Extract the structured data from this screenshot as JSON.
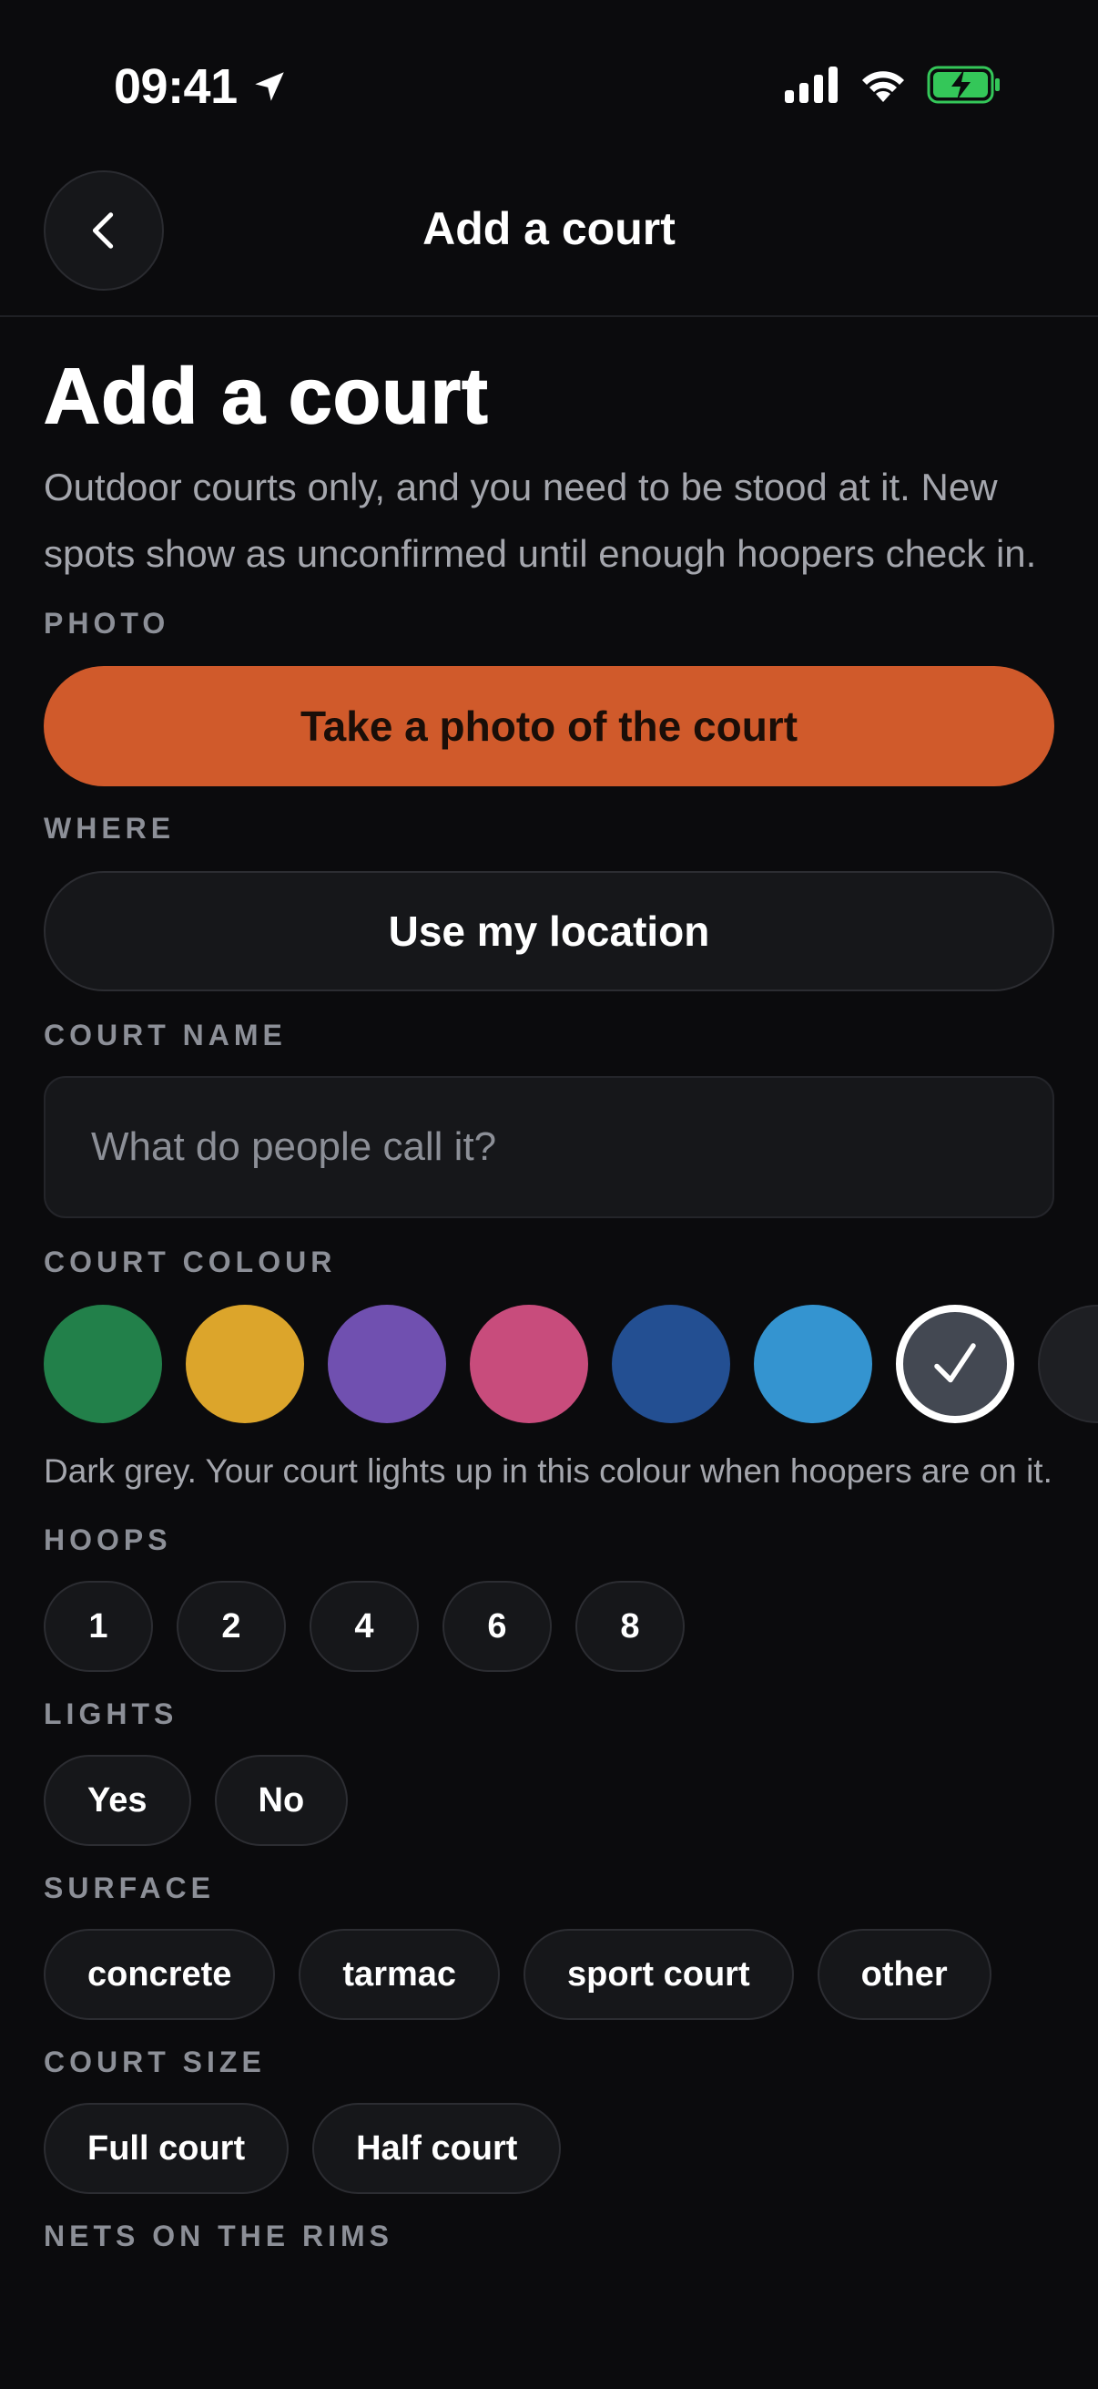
{
  "status_bar": {
    "time": "09:41"
  },
  "nav": {
    "title": "Add a court"
  },
  "page": {
    "title": "Add a court",
    "subtitle": "Outdoor courts only, and you need to be stood at it. New spots show as unconfirmed until enough hoopers check in."
  },
  "photo": {
    "label": "PHOTO",
    "button": "Take a photo of the court"
  },
  "where": {
    "label": "WHERE",
    "button": "Use my location"
  },
  "court_name": {
    "label": "COURT NAME",
    "placeholder": "What do people call it?"
  },
  "court_colour": {
    "label": "COURT COLOUR",
    "swatches": [
      "#22804a",
      "#dca52b",
      "#7050b0",
      "#c84c7c",
      "#234f92",
      "#3494d0",
      "#434852",
      "#1e1f23"
    ],
    "selected": "Dark grey",
    "help": "Dark grey. Your court lights up in this colour when hoopers are on it."
  },
  "hoops": {
    "label": "HOOPS",
    "options": [
      "1",
      "2",
      "4",
      "6",
      "8"
    ]
  },
  "lights": {
    "label": "LIGHTS",
    "options": [
      "Yes",
      "No"
    ]
  },
  "surface": {
    "label": "SURFACE",
    "options": [
      "concrete",
      "tarmac",
      "sport court",
      "other"
    ]
  },
  "court_size": {
    "label": "COURT SIZE",
    "options": [
      "Full court",
      "Half court"
    ]
  },
  "nets": {
    "label": "NETS ON THE RIMS"
  },
  "colors": {
    "accent": "#d05a2b",
    "background": "#0b0b0d",
    "surface": "#16171a",
    "battery": "#34c759"
  }
}
